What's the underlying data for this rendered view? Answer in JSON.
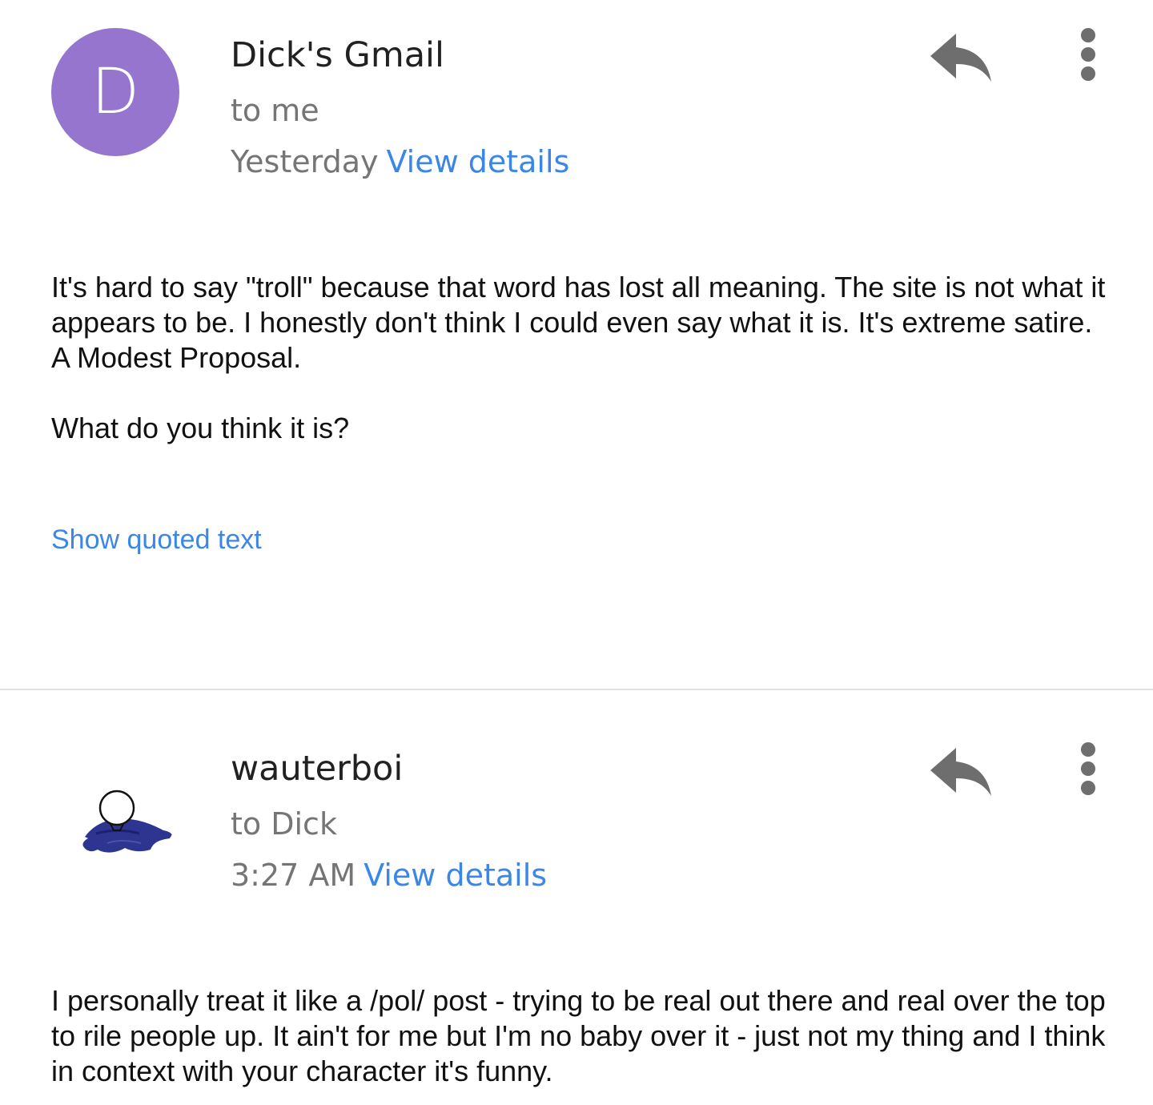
{
  "colors": {
    "avatar_purple": "#9575cd",
    "link_blue": "#3b86e6",
    "secondary_text": "#757575",
    "icon_gray": "#6e6e6e",
    "divider": "#e0e0e0"
  },
  "messages": [
    {
      "avatar_letter": "D",
      "sender": "Dick's Gmail",
      "recipient": "to me",
      "time": "Yesterday",
      "view_details": "View details",
      "reply_icon": "reply-icon",
      "more_icon": "more-vert-icon",
      "body": {
        "line1": "It's hard to say \"troll\" because that word has lost all meaning. The site is not what it appears to be. I honestly don't think I could even say what it is. It's extreme satire. A Modest Proposal.",
        "line2": "What do you think it is?"
      },
      "show_quoted": "Show quoted text"
    },
    {
      "avatar_icon": "user-drawing-avatar",
      "sender": "wauterboi",
      "recipient": "to Dick",
      "time": "3:27 AM",
      "view_details": "View details",
      "reply_icon": "reply-icon",
      "more_icon": "more-vert-icon",
      "body": {
        "line1": "I personally treat it like a /pol/ post - trying to be real out there and real over the top to rile people up. It ain't for me but I'm no baby over it - just not my thing and I think in context with your character it's funny."
      }
    }
  ]
}
